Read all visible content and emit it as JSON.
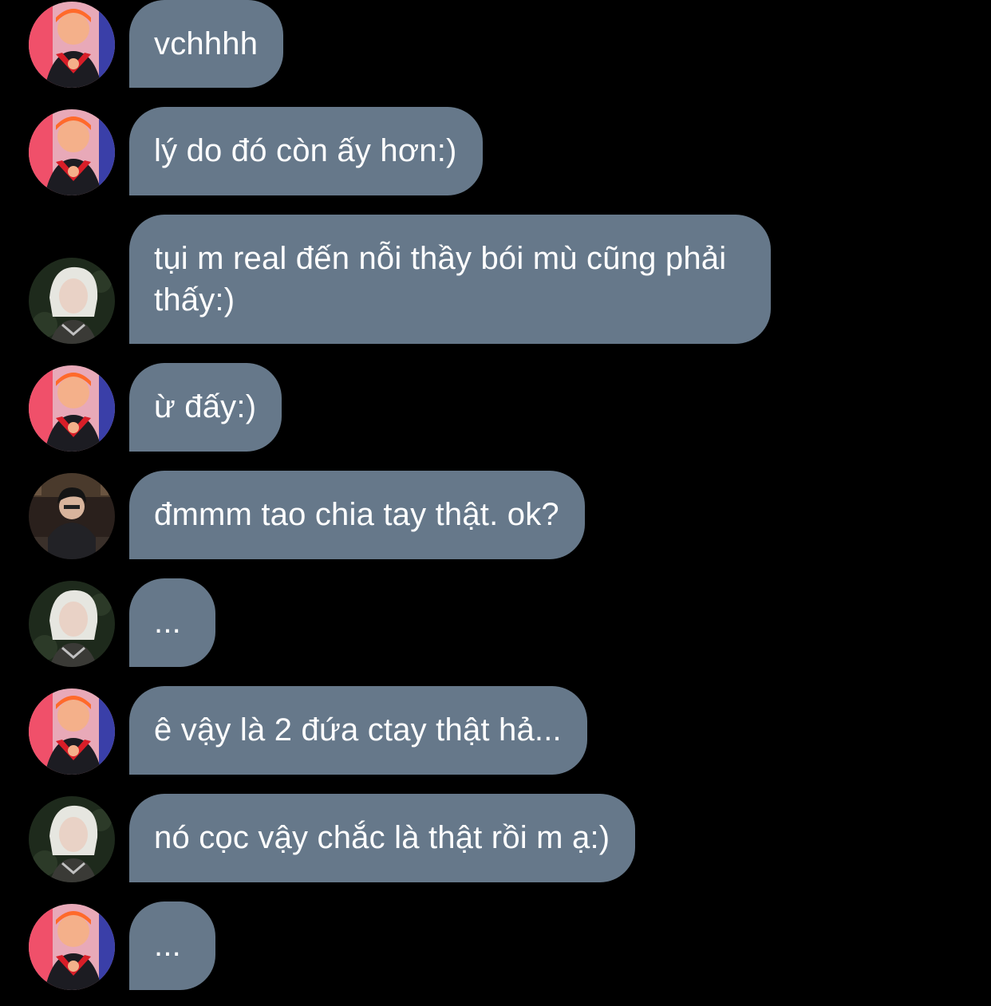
{
  "conversation": {
    "messages": [
      {
        "sender": "orange-hair",
        "text": "vchhhh"
      },
      {
        "sender": "orange-hair",
        "text": "lý do đó còn ấy hơn:)"
      },
      {
        "sender": "white-hair",
        "text": "tụi m real đến nỗi thầy bói mù cũng phải thấy:)"
      },
      {
        "sender": "orange-hair",
        "text": "ừ đấy:)"
      },
      {
        "sender": "dark-hair",
        "text": "đmmm tao chia tay thật. ok?"
      },
      {
        "sender": "white-hair",
        "text": "..."
      },
      {
        "sender": "orange-hair",
        "text": "ê vậy là 2 đứa ctay thật hả..."
      },
      {
        "sender": "white-hair",
        "text": "nó cọc vậy chắc là thật rồi m ạ:)"
      },
      {
        "sender": "orange-hair",
        "text": "..."
      }
    ]
  },
  "colors": {
    "background": "#000000",
    "bubble": "#66788a",
    "bubble_text": "#ffffff"
  }
}
